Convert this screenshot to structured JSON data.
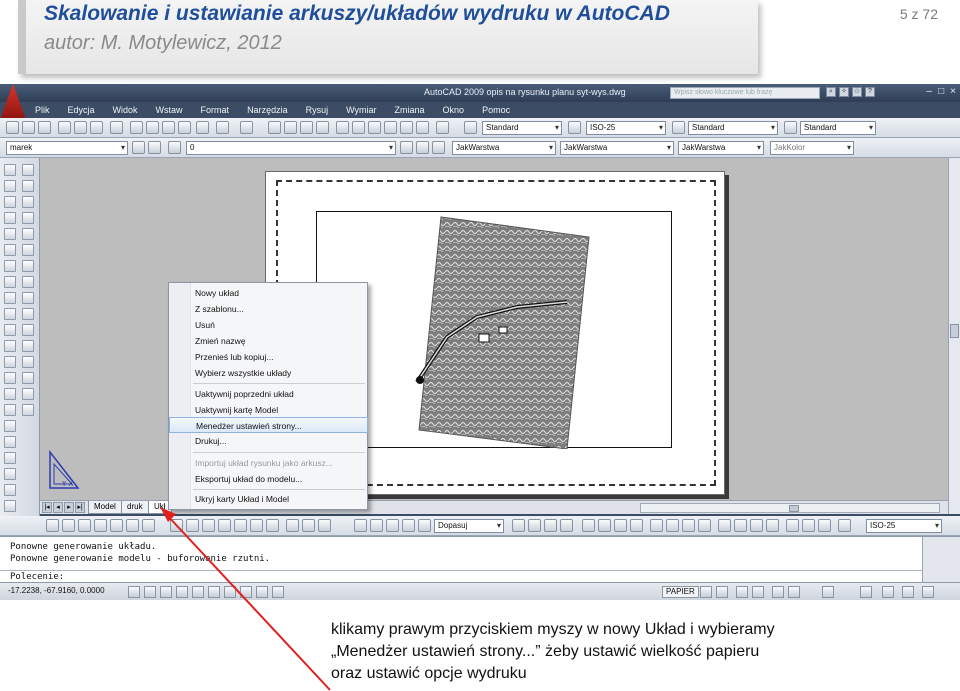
{
  "slide": {
    "title": "Skalowanie i ustawianie arkuszy/układów wydruku w AutoCAD",
    "author": "autor: M. Motylewicz, 2012",
    "page": "5 z 72"
  },
  "app": {
    "window_title": "AutoCAD 2009  opis na rysunku planu syt-wys.dwg",
    "search_placeholder": "Wpisz słowo kluczowe lub frazę",
    "window_controls": [
      "–",
      "□",
      "×"
    ]
  },
  "menu": [
    "Plik",
    "Edycja",
    "Widok",
    "Wstaw",
    "Format",
    "Narzędzia",
    "Rysuj",
    "Wymiar",
    "Zmiana",
    "Okno",
    "Pomoc"
  ],
  "toolbar1": {
    "text_style": "Standard",
    "dim_style": "ISO-25",
    "table_style": "Standard",
    "mleader_style": "Standard"
  },
  "toolbar2": {
    "workspace": "marek",
    "layer": "0",
    "color": "JakWarstwa",
    "linetype": "JakWarstwa",
    "lineweight": "JakWarstwa",
    "plotstyle": "JakKolor"
  },
  "layout_tabs": [
    "Model",
    "druk",
    "Ukł"
  ],
  "layout_tab_nav": [
    "|◂",
    "◂",
    "▸",
    "▸|"
  ],
  "context_menu": {
    "items": [
      {
        "label": "Nowy układ",
        "disabled": false
      },
      {
        "label": "Z szablonu...",
        "disabled": false
      },
      {
        "label": "Usuń",
        "disabled": false
      },
      {
        "label": "Zmień nazwę",
        "disabled": false
      },
      {
        "label": "Przenieś lub kopiuj...",
        "disabled": false
      },
      {
        "label": "Wybierz wszystkie układy",
        "disabled": false
      },
      {
        "label": "Uaktywnij poprzedni układ",
        "disabled": false
      },
      {
        "label": "Uaktywnij kartę Model",
        "disabled": false
      },
      {
        "label": "Menedżer ustawień strony...",
        "disabled": false,
        "highlighted": true
      },
      {
        "label": "Drukuj...",
        "disabled": false
      },
      {
        "label": "Importuj układ rysunku jako arkusz...",
        "disabled": true
      },
      {
        "label": "Eksportuj układ do modelu...",
        "disabled": false
      },
      {
        "label": "Ukryj karty Układ i Model",
        "disabled": false
      }
    ]
  },
  "bottom_toolbar": {
    "zoom_combo": "Dopasuj",
    "dim_style": "ISO-25"
  },
  "command": {
    "history1": "Ponowne generowanie układu.",
    "history2": "Ponowne generowanie modelu - buforowanie rzutni.",
    "prompt": "Polecenie:"
  },
  "status": {
    "coordinates": "-17.2238, -67.9160, 0.0000",
    "space": "PAPIER"
  },
  "caption": {
    "line1": "klikamy prawym przyciskiem myszy w nowy Układ i wybieramy",
    "line2": "„Menedżer ustawień strony...” żeby ustawić wielkość papieru",
    "line3": "oraz ustawić opcje wydruku"
  },
  "colors": {
    "title_blue": "#1f4e9a",
    "author_gray": "#8a8a8a",
    "arrow_red": "#e02020",
    "acad_frame": "#3b4c64"
  }
}
